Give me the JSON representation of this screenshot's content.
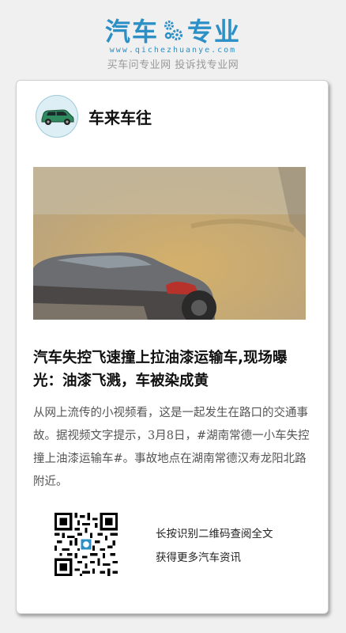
{
  "brand": {
    "name_left": "汽车",
    "name_right": "专业",
    "url": "www.qichezhuanye.com",
    "slogan": "买车问专业网 投诉找专业网",
    "color": "#2c8fc6"
  },
  "author": {
    "name": "车来车往",
    "avatar_icon": "car-icon"
  },
  "article": {
    "headline": "汽车失控飞速撞上拉油漆运输车,现场曝光：油漆飞溅，车被染成黄",
    "body": "从网上流传的小视频看，这是一起发生在路口的交通事故。据视频文字提示，3月8日，#湖南常德一小车失控撞上油漆运输车#。事故地点在湖南常德汉寿龙阳北路附近。"
  },
  "qr": {
    "line1": "长按识别二维码查阅全文",
    "line2": "获得更多汽车资讯"
  }
}
